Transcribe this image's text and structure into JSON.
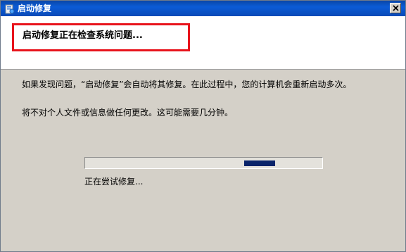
{
  "window": {
    "title": "启动修复",
    "icon": "startup-repair-icon",
    "close_icon": "close-icon"
  },
  "header": {
    "heading": "启动修复正在检查系统问题..."
  },
  "body": {
    "paragraph1": "如果发现问题，“启动修复”会自动将其修复。在此过程中，您的计算机会重新启动多次。",
    "paragraph2": "将不对个人文件或信息做任何更改。这可能需要几分钟。"
  },
  "progress": {
    "style": "marquee",
    "segment_start_fraction": 0.67,
    "segment_length_fraction": 0.13,
    "status_text": "正在尝试修复..."
  },
  "colors": {
    "titlebar": "#0b5bd6",
    "highlight_border": "#e8141c",
    "progress_fill": "#0a246a",
    "dialog_background": "#d4d0c8"
  }
}
